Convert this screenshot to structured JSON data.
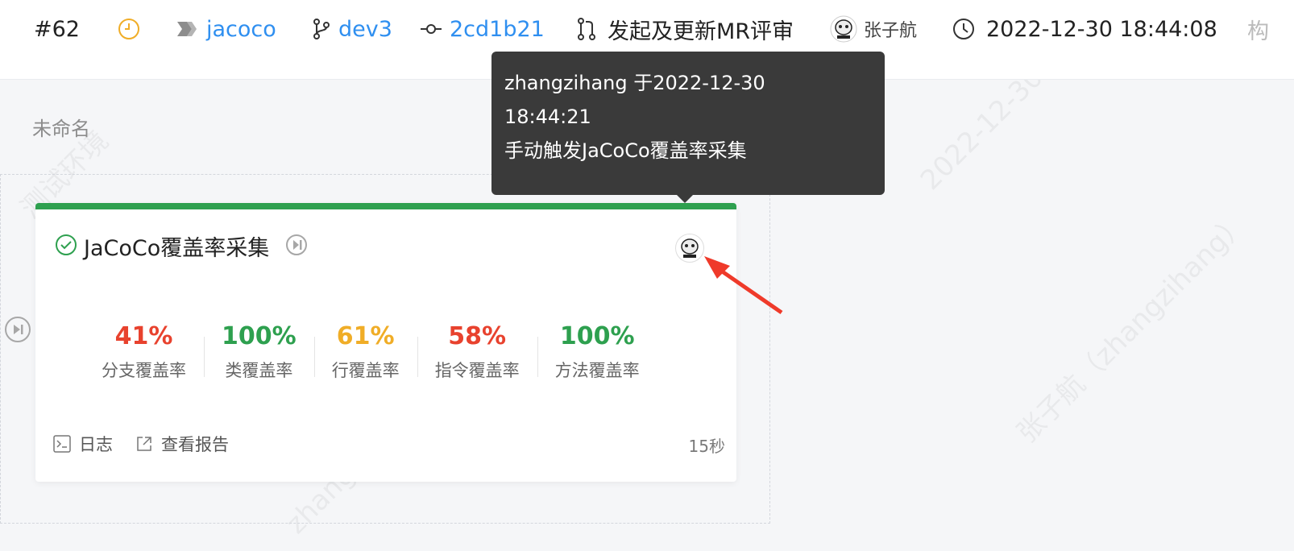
{
  "header": {
    "build_number": "#62",
    "repo": "jacoco",
    "branch": "dev3",
    "commit": "2cd1b21",
    "mr_action": "发起及更新MR评审",
    "user": "张子航",
    "datetime": "2022-12-30 18:44:08",
    "cut_label": "构"
  },
  "stage": {
    "name": "未命名"
  },
  "job_card": {
    "title": "JaCoCo覆盖率采集",
    "metrics": [
      {
        "value": "41%",
        "label": "分支覆盖率",
        "color": "#e8422e"
      },
      {
        "value": "100%",
        "label": "类覆盖率",
        "color": "#2ea04f"
      },
      {
        "value": "61%",
        "label": "行覆盖率",
        "color": "#f0ad27"
      },
      {
        "value": "58%",
        "label": "指令覆盖率",
        "color": "#e8422e"
      },
      {
        "value": "100%",
        "label": "方法覆盖率",
        "color": "#2ea04f"
      }
    ],
    "footer": {
      "log_label": "日志",
      "report_label": "查看报告",
      "duration": "15秒"
    }
  },
  "tooltip": {
    "line1": "zhangzihang 于2022-12-30",
    "line2": "18:44:21",
    "line3": "手动触发JaCoCo覆盖率采集"
  },
  "colors": {
    "link": "#2f8ff0",
    "success": "#2ea04f",
    "warning": "#f0ad27",
    "danger": "#e8422e",
    "tooltip_bg": "#3a3a3a"
  }
}
